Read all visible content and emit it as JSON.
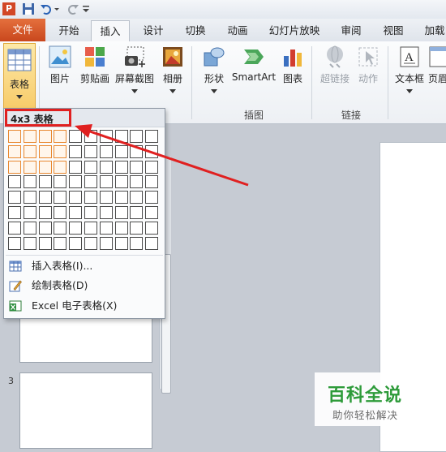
{
  "tabs": {
    "file": "文件",
    "home": "开始",
    "insert": "插入",
    "design": "设计",
    "transitions": "切换",
    "animations": "动画",
    "slideshow": "幻灯片放映",
    "review": "审阅",
    "view": "视图",
    "addins": "加载"
  },
  "ribbon": {
    "table": "表格",
    "picture": "图片",
    "clipart": "剪贴画",
    "screenshot": "屏幕截图",
    "album": "相册",
    "shapes": "形状",
    "smartart": "SmartArt",
    "chart": "图表",
    "hyperlink": "超链接",
    "action": "动作",
    "textbox": "文本框",
    "header": "页眉",
    "group_illustrations": "插图",
    "group_links": "链接"
  },
  "dropdown": {
    "header": "4x3 表格",
    "items": [
      "插入表格(I)...",
      "绘制表格(D)",
      "Excel 电子表格(X)"
    ],
    "grid_cols": 10,
    "grid_rows": 8,
    "selected_cols": 4,
    "selected_rows": 3
  },
  "slides": {
    "number3": "3"
  },
  "watermark": {
    "title": "百科全说",
    "subtitle": "助你轻松解决"
  },
  "colors": {
    "file_tab": "#d0541f",
    "highlight": "#e02020",
    "grid_selected": "#e8872e",
    "watermark_green": "#2e9b3a"
  }
}
